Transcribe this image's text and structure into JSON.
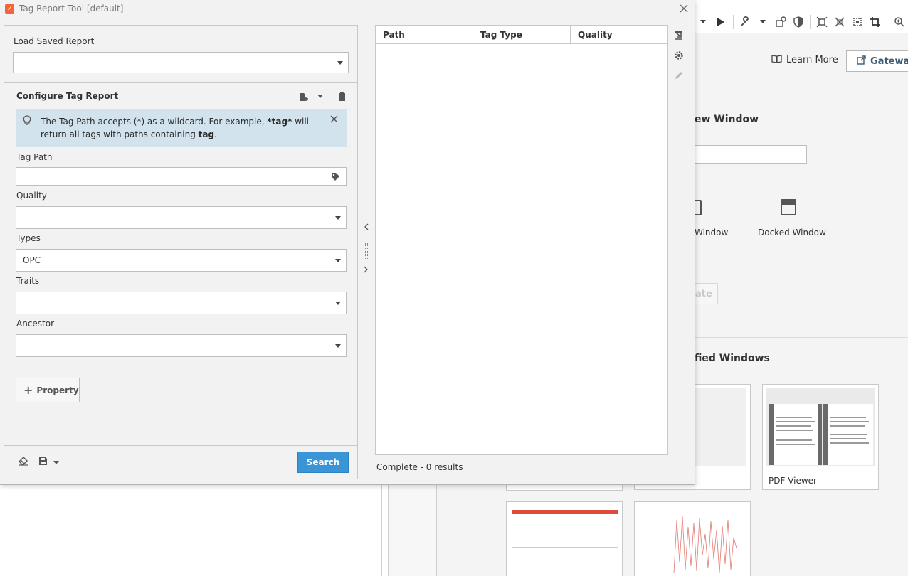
{
  "window": {
    "title": "Tag Report Tool [default]",
    "logo_glyph": "✓"
  },
  "left_panel": {
    "load_saved_report_label": "Load Saved Report",
    "configure_title": "Configure Tag Report",
    "tip": {
      "text_before": "The Tag Path accepts (*) as a wildcard. For example, ",
      "bold_example": "*tag*",
      "text_middle": " will return all tags with paths containing ",
      "bold_term": "tag",
      "text_after": "."
    },
    "fields": {
      "tag_path_label": "Tag Path",
      "quality_label": "Quality",
      "types_label": "Types",
      "types_value": "OPC",
      "traits_label": "Traits",
      "ancestor_label": "Ancestor"
    },
    "property_button": "Property",
    "search_button": "Search"
  },
  "results": {
    "columns": [
      "Path",
      "Tag Type",
      "Quality"
    ],
    "status": "Complete - 0 results"
  },
  "background": {
    "learn_more": "Learn More",
    "gateway": "Gateway",
    "new_window_title": "ew Window",
    "window_label_a": "Window",
    "window_label_b": "Docked Window",
    "create_label": "ate",
    "modified_title": "fied Windows",
    "thumb_caption_a": "",
    "thumb_caption_pdf": "PDF Viewer"
  },
  "colors": {
    "accent": "#3a95d6",
    "tip_background": "#d3e3ee",
    "logo": "#f0663a"
  }
}
